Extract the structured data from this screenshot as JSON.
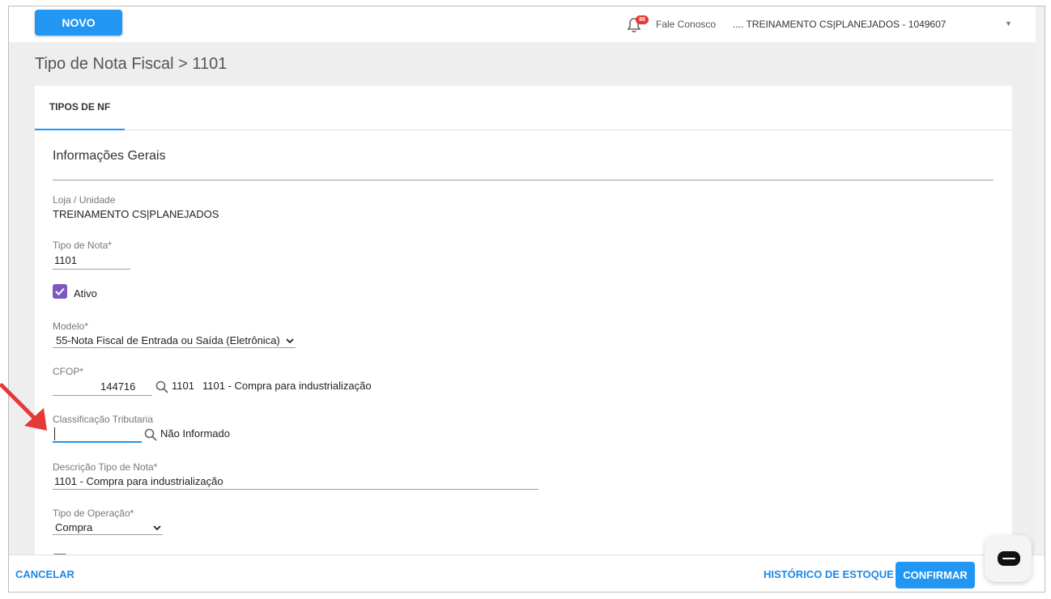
{
  "header": {
    "new_button": "NOVO",
    "notification_count": "88",
    "contact_link": "Fale Conosco",
    "company_selector": ".... TREINAMENTO CS|PLANEJADOS - 1049607"
  },
  "page": {
    "title": "Tipo de Nota Fiscal > 1101"
  },
  "tabs": [
    {
      "label": "TIPOS DE NF",
      "active": true
    }
  ],
  "section": {
    "title": "Informações Gerais"
  },
  "form": {
    "loja": {
      "label": "Loja / Unidade",
      "value": "TREINAMENTO CS|PLANEJADOS"
    },
    "tipo_nota": {
      "label": "Tipo de Nota*",
      "value": "1101"
    },
    "ativo": {
      "label": "Ativo",
      "checked": true
    },
    "modelo": {
      "label": "Modelo*",
      "value": "55-Nota Fiscal de Entrada ou Saída (Eletrônica)"
    },
    "cfop": {
      "label": "CFOP*",
      "value": "144716",
      "code": "1101",
      "description": "1101 - Compra para industrialização"
    },
    "classificacao": {
      "label": "Classificação Tributaria",
      "value": "",
      "description": "Não Informado"
    },
    "descricao": {
      "label": "Descrição Tipo de Nota*",
      "value": "1101 - Compra para industrialização"
    },
    "tipo_operacao": {
      "label": "Tipo de Operação*",
      "value": "Compra"
    }
  },
  "footer": {
    "cancel": "CANCELAR",
    "history": "HISTÓRICO DE ESTOQUE",
    "confirm": "CONFIRMAR"
  },
  "colors": {
    "primary": "#2196f3",
    "link": "#1e88e5",
    "checkbox": "#7e57c2",
    "badge": "#e53935",
    "annotation_arrow": "#e53935"
  }
}
